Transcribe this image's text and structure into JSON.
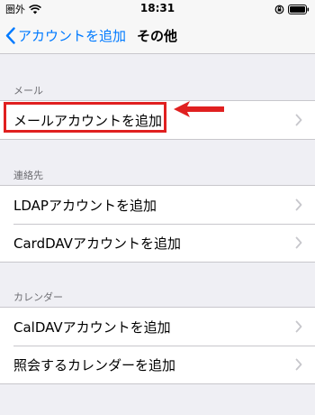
{
  "status_bar": {
    "carrier": "圏外",
    "time": "18:31"
  },
  "nav": {
    "back_label": "アカウントを追加",
    "title": "その他"
  },
  "sections": [
    {
      "header": "メール",
      "items": [
        "メールアカウントを追加"
      ]
    },
    {
      "header": "連絡先",
      "items": [
        "LDAPアカウントを追加",
        "CardDAVアカウントを追加"
      ]
    },
    {
      "header": "カレンダー",
      "items": [
        "CalDAVアカウントを追加",
        "照会するカレンダーを追加"
      ]
    }
  ],
  "colors": {
    "accent": "#007aff",
    "highlight": "#e02020",
    "background": "#efeff4"
  }
}
